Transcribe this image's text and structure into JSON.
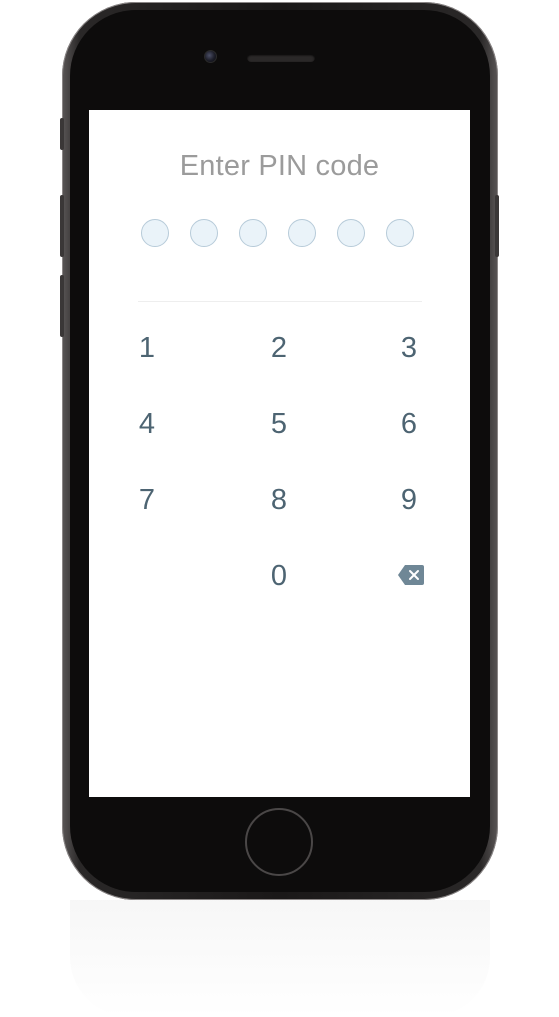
{
  "pin_screen": {
    "title": "Enter PIN code",
    "pin_length": 6,
    "entered_digits": 0,
    "keys": [
      "1",
      "2",
      "3",
      "4",
      "5",
      "6",
      "7",
      "8",
      "9",
      "0"
    ],
    "backspace_icon": "backspace-icon"
  },
  "colors": {
    "title": "#9b9b9b",
    "key_text": "#4d6472",
    "dot_fill": "#eaf3f9",
    "dot_border": "#b7cbd9",
    "backspace": "#6f8796"
  }
}
